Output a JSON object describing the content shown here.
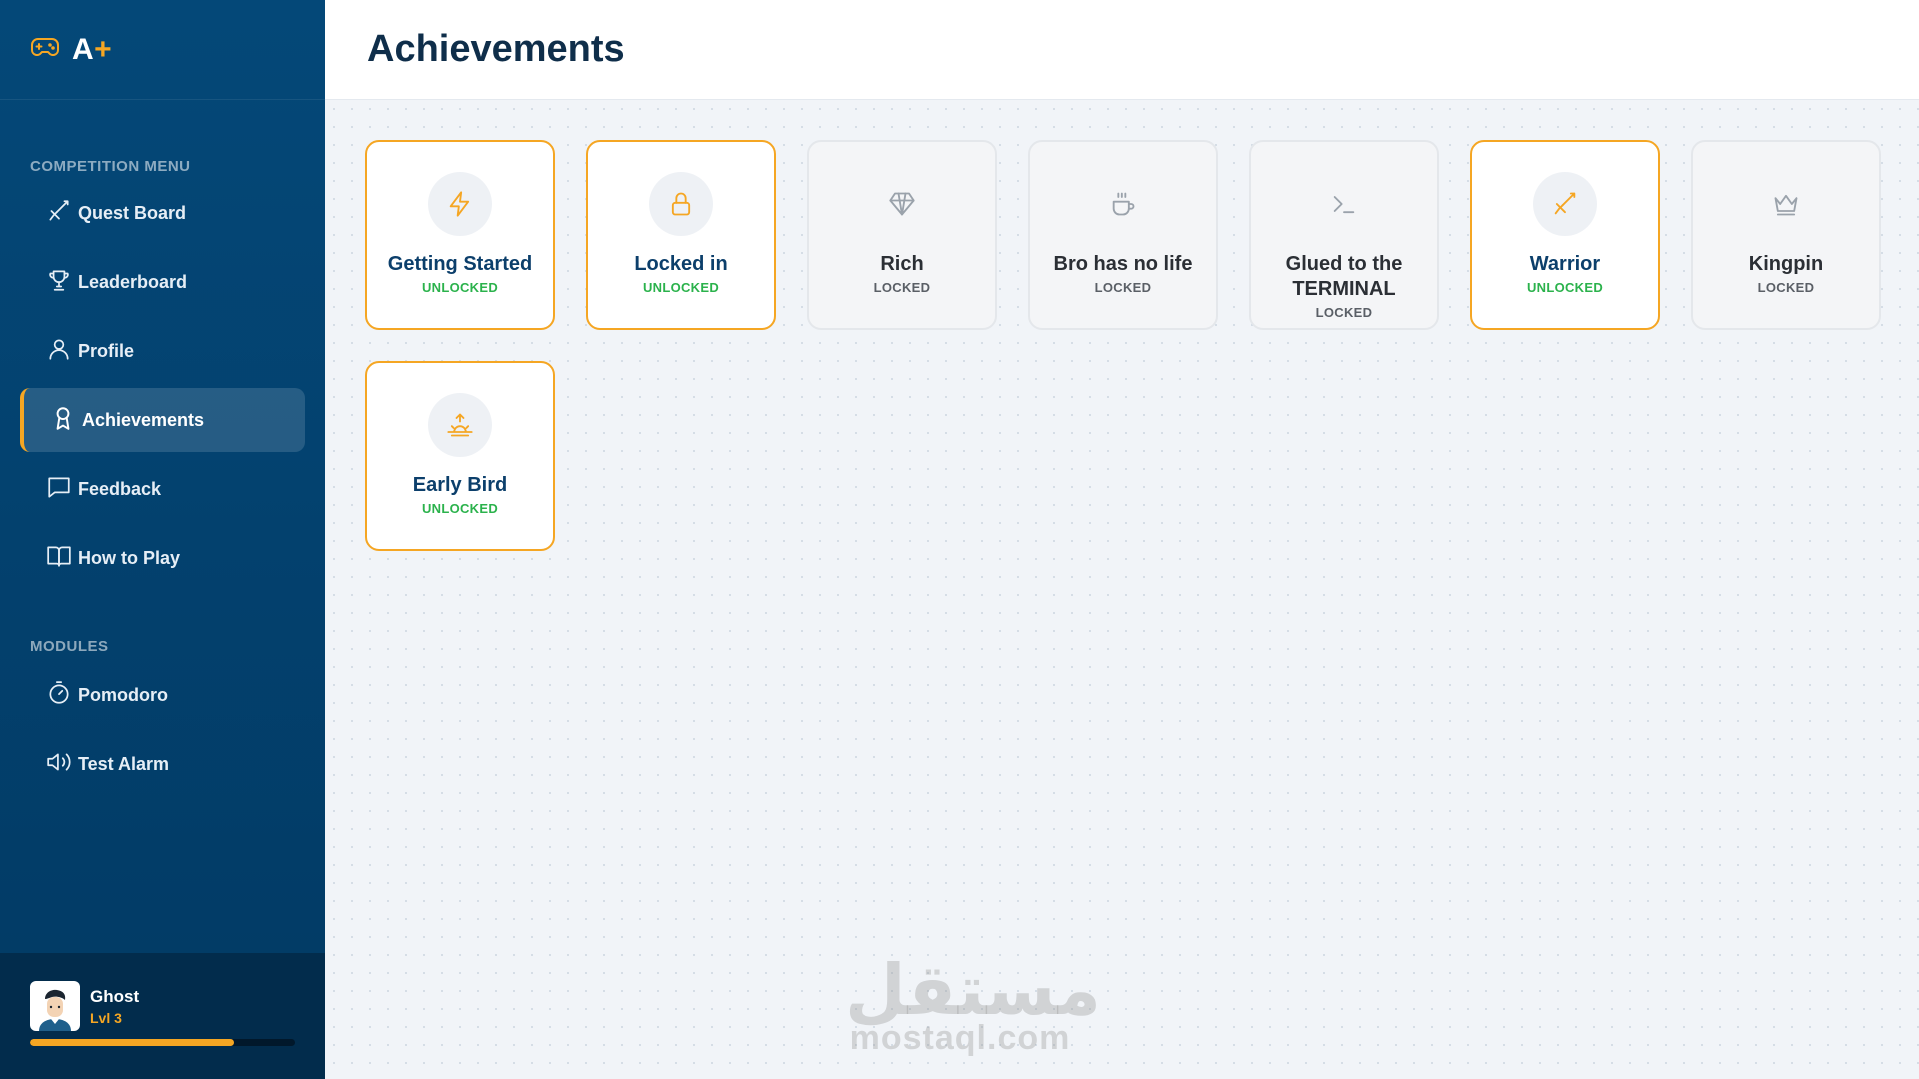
{
  "brand": {
    "text": "A",
    "plus": "+"
  },
  "sidebar": {
    "competition_label": "COMPETITION MENU",
    "competition_items": [
      {
        "label": "Quest Board",
        "icon": "sword-icon"
      },
      {
        "label": "Leaderboard",
        "icon": "trophy-icon"
      },
      {
        "label": "Profile",
        "icon": "user-icon"
      },
      {
        "label": "Achievements",
        "icon": "award-icon",
        "active": true
      },
      {
        "label": "Feedback",
        "icon": "message-icon"
      },
      {
        "label": "How to Play",
        "icon": "book-icon"
      }
    ],
    "modules_label": "MODULES",
    "module_items": [
      {
        "label": "Pomodoro",
        "icon": "timer-icon"
      },
      {
        "label": "Test Alarm",
        "icon": "speaker-icon"
      }
    ]
  },
  "user": {
    "name": "Ghost",
    "level": "Lvl 3",
    "xp_fraction": 0.77
  },
  "header": {
    "title": "Achievements"
  },
  "achievements": [
    {
      "title": "Getting Started",
      "status": "UNLOCKED",
      "icon": "lightning-icon"
    },
    {
      "title": "Locked in",
      "status": "UNLOCKED",
      "icon": "lock-icon"
    },
    {
      "title": "Rich",
      "status": "LOCKED",
      "icon": "diamond-icon"
    },
    {
      "title": "Bro has no life",
      "status": "LOCKED",
      "icon": "coffee-icon"
    },
    {
      "title": "Glued to the TERMINAL",
      "status": "LOCKED",
      "icon": "terminal-icon"
    },
    {
      "title": "Warrior",
      "status": "UNLOCKED",
      "icon": "sword-icon"
    },
    {
      "title": "Kingpin",
      "status": "LOCKED",
      "icon": "crown-icon"
    },
    {
      "title": "Early Bird",
      "status": "UNLOCKED",
      "icon": "sunrise-icon"
    }
  ],
  "watermark": {
    "arabic": "مستقل",
    "latin": "mostaql.com"
  },
  "colors": {
    "accent": "#f5a623",
    "sidebar": "#044878",
    "unlocked": "#2bb24c",
    "title": "#0f2e4a"
  }
}
